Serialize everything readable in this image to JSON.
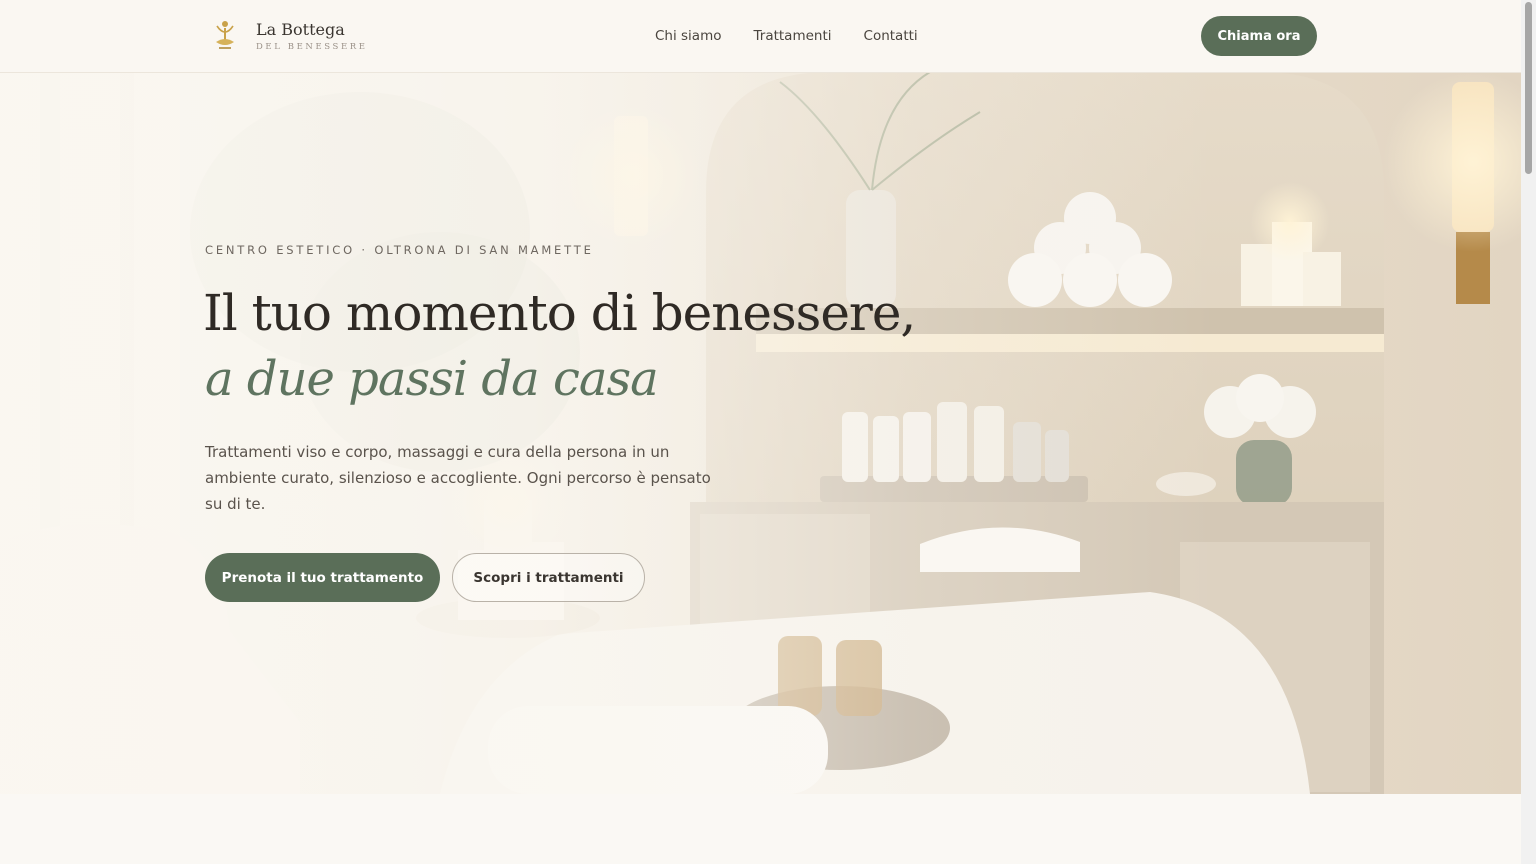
{
  "brand": {
    "title": "La Bottega",
    "subtitle": "DEL BENESSERE",
    "logo_icon": "lotus-figure-icon",
    "accent_color": "#5a6e58"
  },
  "nav": {
    "items": [
      {
        "label": "Chi siamo"
      },
      {
        "label": "Trattamenti"
      },
      {
        "label": "Contatti"
      }
    ]
  },
  "header": {
    "call_label": "Chiama ora"
  },
  "hero": {
    "eyebrow": "CENTRO ESTETICO · OLTRONA DI SAN MAMETTE",
    "title_line1": "Il tuo momento di benessere,",
    "title_line2": "a due passi da casa",
    "lead": "Trattamenti viso e corpo, massaggi e cura della persona in un ambiente curato, silenzioso e accogliente. Ogni percorso è pensato su di te.",
    "primary_cta": "Prenota il tuo trattamento",
    "secondary_cta": "Scopri i trattamenti",
    "background": "spa-treatment-room-image"
  }
}
